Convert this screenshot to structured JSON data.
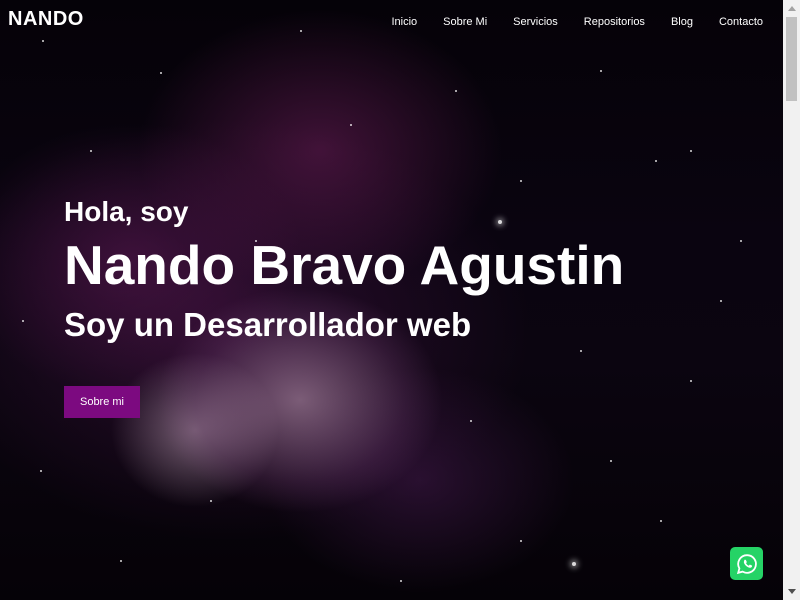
{
  "navbar": {
    "brand": "NANDO",
    "links": [
      "Inicio",
      "Sobre Mi",
      "Servicios",
      "Repositorios",
      "Blog",
      "Contacto"
    ]
  },
  "hero": {
    "greeting": "Hola, soy",
    "name": "Nando Bravo Agustin",
    "role": "Soy un Desarrollador web",
    "button_label": "Sobre mi"
  },
  "colors": {
    "accent": "#7c0a80",
    "whatsapp": "#25d366",
    "text": "#ffffff"
  },
  "icons": {
    "floating_button": "whatsapp-icon"
  }
}
